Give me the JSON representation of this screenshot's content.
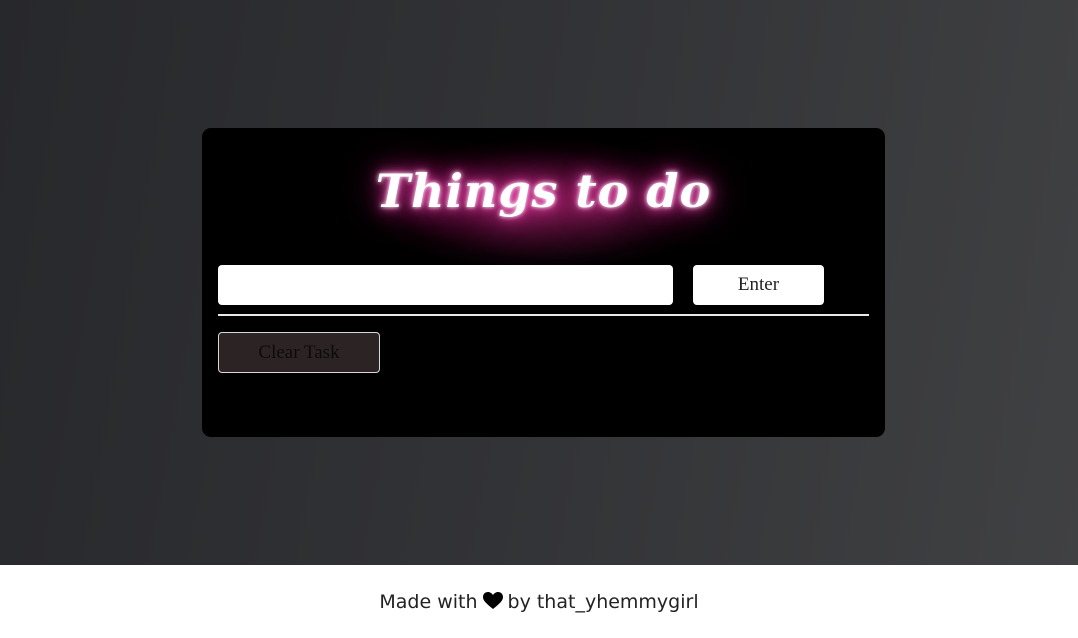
{
  "card": {
    "title": "Things to do",
    "task_input": {
      "value": "",
      "placeholder": ""
    },
    "enter_label": "Enter",
    "clear_label": "Clear Task"
  },
  "footer": {
    "prefix": "Made with",
    "icon": "heart-icon",
    "suffix": "by that_yhemmygirl"
  },
  "colors": {
    "card_background": "#000000",
    "title_glow": "#e0309a",
    "clear_button_background": "#2c2324"
  }
}
